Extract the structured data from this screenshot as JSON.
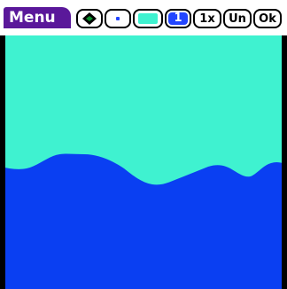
{
  "toolbar": {
    "menu_label": "Menu",
    "buttons": [
      {
        "name": "fill-tool",
        "icon": "paint-bucket-icon"
      },
      {
        "name": "brush-size",
        "icon": "dot-icon"
      },
      {
        "name": "color-swatch",
        "icon": "swatch-icon",
        "color": "#3ff2d0"
      },
      {
        "name": "layer-number",
        "label": "1"
      },
      {
        "name": "zoom",
        "label": "1x"
      },
      {
        "name": "undo",
        "label": "Un"
      },
      {
        "name": "ok",
        "label": "Ok"
      }
    ]
  },
  "canvas": {
    "top_color": "#3ff2d0",
    "bottom_color": "#0a3ff2"
  }
}
